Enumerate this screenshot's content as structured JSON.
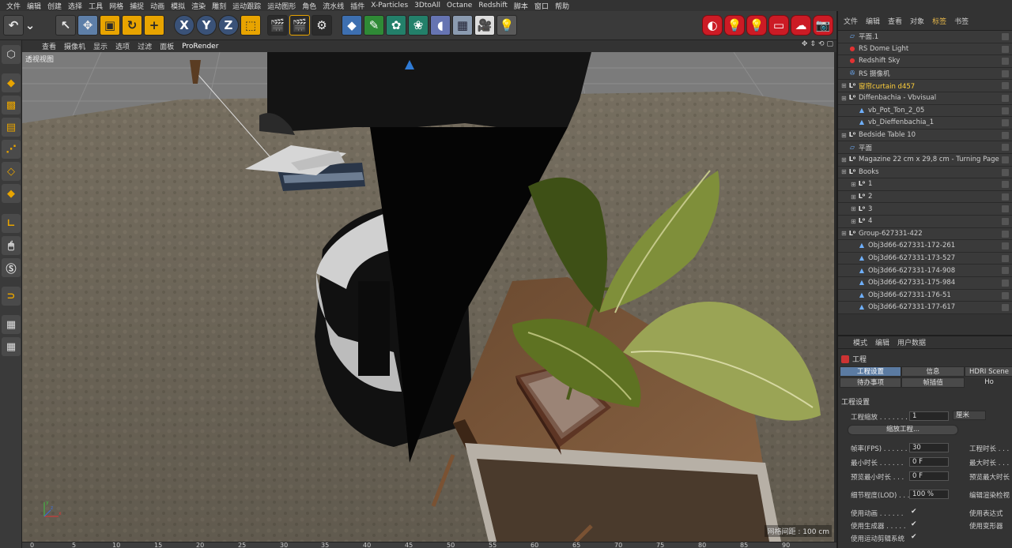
{
  "menu": [
    "文件",
    "编辑",
    "创建",
    "选择",
    "工具",
    "网格",
    "捕捉",
    "动画",
    "模拟",
    "渲染",
    "雕刻",
    "运动跟踪",
    "运动图形",
    "角色",
    "流水线",
    "插件",
    "X-Particles",
    "3DtoAll",
    "Octane",
    "Redshift",
    "脚本",
    "窗口",
    "帮助"
  ],
  "viewport_menu": [
    "查看",
    "摄像机",
    "显示",
    "选项",
    "过滤",
    "面板",
    "ProRender"
  ],
  "viewport_label": "透视视图",
  "grid_spacing": "网格间距 : 100 cm",
  "axis": {
    "x": "x",
    "y": "y",
    "z": "z"
  },
  "toolbar_xyz": [
    "X",
    "Y",
    "Z"
  ],
  "timeline_ticks": [
    "0",
    "5",
    "10",
    "15",
    "20",
    "25",
    "30",
    "35",
    "40",
    "45",
    "50",
    "55",
    "60",
    "65",
    "70",
    "75",
    "80",
    "85",
    "90"
  ],
  "object_manager": {
    "menu": [
      "文件",
      "编辑",
      "查看",
      "对象",
      "标签",
      "书签"
    ],
    "active_menu": "标签",
    "objects": [
      {
        "label": "平面.1",
        "icon": "plane-icon"
      },
      {
        "label": "RS Dome Light",
        "icon": "redshift-light-icon"
      },
      {
        "label": "Redshift Sky",
        "icon": "redshift-sky-icon"
      },
      {
        "label": "RS 摄像机",
        "icon": "camera-icon"
      },
      {
        "label": "窗帘curtain d457",
        "icon": "null-icon",
        "highlight": true
      },
      {
        "label": "Diffenbachia - Vbvisual",
        "icon": "null-icon"
      },
      {
        "label": "vb_Pot_Ton_2_05",
        "icon": "polygon-icon"
      },
      {
        "label": "vb_Dieffenbachia_1",
        "icon": "polygon-icon"
      },
      {
        "label": "Bedside Table 10",
        "icon": "null-icon"
      },
      {
        "label": "平面",
        "icon": "plane-icon"
      },
      {
        "label": "Magazine 22 cm x 29,8 cm - Turning Page",
        "icon": "null-icon"
      },
      {
        "label": "Books",
        "icon": "null-icon"
      },
      {
        "label": "1",
        "icon": "null-icon"
      },
      {
        "label": "2",
        "icon": "null-icon"
      },
      {
        "label": "3",
        "icon": "null-icon"
      },
      {
        "label": "4",
        "icon": "null-icon"
      },
      {
        "label": "Group-627331-422",
        "icon": "null-icon"
      },
      {
        "label": "Obj3d66-627331-172-261",
        "icon": "polygon-icon"
      },
      {
        "label": "Obj3d66-627331-173-527",
        "icon": "polygon-icon"
      },
      {
        "label": "Obj3d66-627331-174-908",
        "icon": "polygon-icon"
      },
      {
        "label": "Obj3d66-627331-175-984",
        "icon": "polygon-icon"
      },
      {
        "label": "Obj3d66-627331-176-51",
        "icon": "polygon-icon"
      },
      {
        "label": "Obj3d66-627331-177-617",
        "icon": "polygon-icon"
      }
    ]
  },
  "attributes": {
    "menu": [
      "模式",
      "编辑",
      "用户数据"
    ],
    "header": "工程",
    "tabs": [
      "工程设置",
      "信息",
      "HDRI Scene Ho",
      "待办事项",
      "帧插值"
    ],
    "active_tab": "工程设置",
    "section": "工程设置",
    "scale_label": "工程缩放 . . . . . . .",
    "scale_value": "1",
    "scale_unit": "厘米",
    "scale_button": "缩放工程...",
    "fps_label": "帧率(FPS) . . . . . .",
    "fps_value": "30",
    "project_length_label": "工程时长 . . .",
    "min_length_label": "最小时长 . . . . . .",
    "min_length_value": "0 F",
    "max_length_label": "最大时长 . . .",
    "preview_min_label": "预览最小时长 . . .",
    "preview_min_value": "0 F",
    "preview_max_label": "预览最大时长",
    "lod_label": "细节程度(LOD) . . .",
    "lod_value": "100 %",
    "render_lod_label": "编辑渲染检视",
    "use_animation_label": "使用动画 . . . . . .",
    "use_expressions_label": "使用表达式",
    "use_generators_label": "使用生成器 . . . . .",
    "use_deformers_label": "使用变形器",
    "use_motion_label": "使用运动剪辑系统",
    "check": "✔"
  }
}
